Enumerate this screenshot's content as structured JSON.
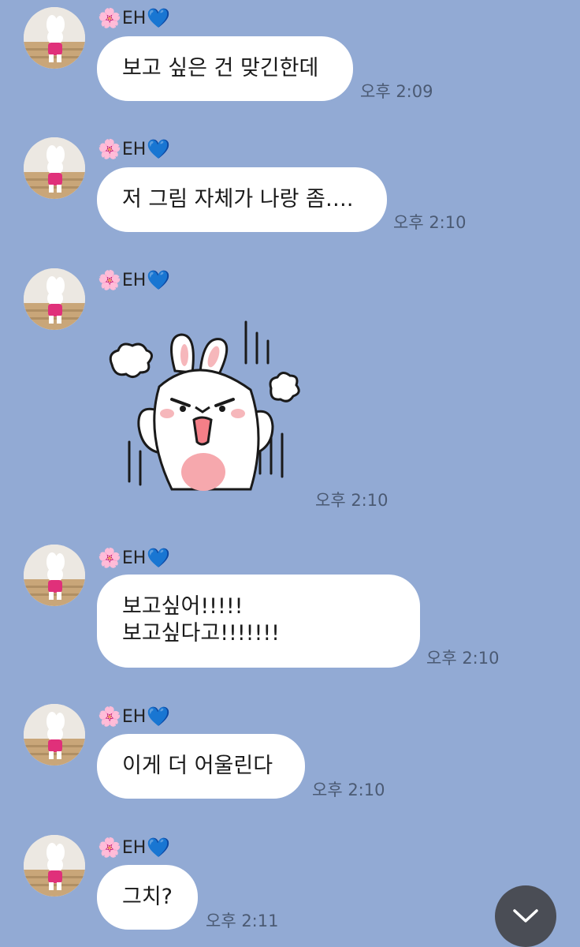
{
  "sender": {
    "name": "EH",
    "prefix_emoji": "🌸",
    "suffix_emoji": "💙"
  },
  "messages": [
    {
      "text": "보고 싶은 건 맞긴한데",
      "time": "오후 2:09"
    },
    {
      "text": "저 그림 자체가 나랑 좀….",
      "time": "오후 2:10"
    },
    {
      "sticker": "angry-bunny-sticker",
      "time": "오후 2:10"
    },
    {
      "text": "보고싶어!!!!!\n보고싶다고!!!!!!!",
      "time": "오후 2:10"
    },
    {
      "text": "이게 더 어울린다",
      "time": "오후 2:10"
    },
    {
      "text": "그치?",
      "time": "오후 2:11"
    }
  ],
  "scroll_button": {
    "icon": "chevron-down-icon"
  },
  "colors": {
    "background": "#92aad4",
    "bubble": "#ffffff",
    "timestamp": "#4b5a73",
    "scroll_button": "#4a4d55"
  }
}
